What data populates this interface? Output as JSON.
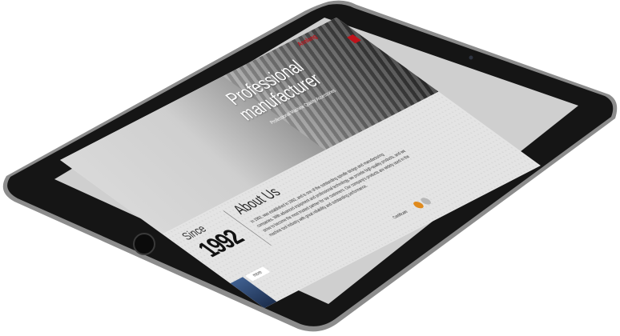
{
  "site": {
    "logo_text": "Annlang",
    "hero": {
      "title_line1": "Professional",
      "title_line2": "manufacturer",
      "subtitle": "Professional Machine Quality Accessories"
    },
    "since_label": "Since",
    "since_year": "1992",
    "about": {
      "title": "About Us",
      "text": "In 1992, was established in 1992, and is one of the outstanding spindle design and manufacturing companies. With advanced equipment and professional technology, we provide high-quality products, and we strive to become the most trusted partner for our customers. Our company's products are widely used in the machine tool industry with great reliability and outstanding performance."
    },
    "more_button": "more",
    "certificate_label": "Certificate"
  },
  "colors": {
    "brand": "#c0121a",
    "device_frame": "#1a1a1a",
    "device_bezel": "#2b2b2b"
  },
  "icons": [
    "menu-icon",
    "home-button-icon",
    "camera-icon",
    "certificate-icon"
  ]
}
